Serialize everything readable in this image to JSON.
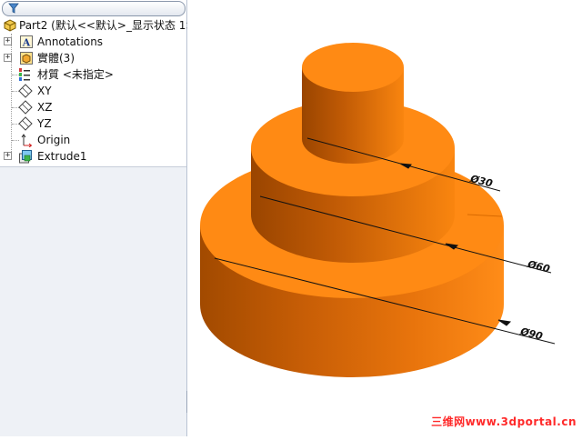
{
  "tree": {
    "part_label": "Part2  (默认<<默认>_显示状态 1>",
    "items": [
      {
        "label": "Annotations",
        "icon": "annotations-icon",
        "expandable": true
      },
      {
        "label": "實體(3)",
        "icon": "solid-bodies-icon",
        "expandable": true
      },
      {
        "label": "材質 <未指定>",
        "icon": "material-icon",
        "expandable": false
      },
      {
        "label": "XY",
        "icon": "plane-icon",
        "expandable": false
      },
      {
        "label": "XZ",
        "icon": "plane-icon",
        "expandable": false
      },
      {
        "label": "YZ",
        "icon": "plane-icon",
        "expandable": false
      },
      {
        "label": "Origin",
        "icon": "origin-icon",
        "expandable": false
      },
      {
        "label": "Extrude1",
        "icon": "extrude-icon",
        "expandable": true
      }
    ]
  },
  "model": {
    "color_top": "#ff8a14",
    "color_side_light": "#f07a0c",
    "color_side_dark": "#a24a00",
    "dimensions": [
      "Ø30",
      "Ø60",
      "Ø90"
    ]
  },
  "watermark": "三维网www.3dportal.cn"
}
